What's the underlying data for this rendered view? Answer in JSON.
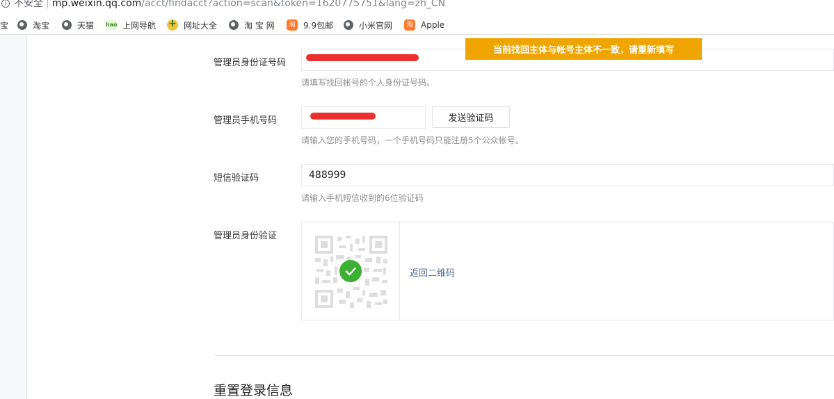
{
  "browser": {
    "security_label": "不安全",
    "url_host": "mp.weixin.qq.com",
    "url_path": "/acct/findacct?action=scan&token=1620775751&lang=zh_CN",
    "bookmarks": [
      {
        "label": "宝",
        "icon": "bookmark-partial"
      },
      {
        "label": "淘宝",
        "icon": "globe-icon"
      },
      {
        "label": "天猫",
        "icon": "globe-icon"
      },
      {
        "label": "上网导航",
        "icon": "hao-icon"
      },
      {
        "label": "网址大全",
        "icon": "nav-icon"
      },
      {
        "label": "淘 宝 网",
        "icon": "globe-icon"
      },
      {
        "label": "9.9包邮",
        "icon": "taobao-icon"
      },
      {
        "label": "小米官网",
        "icon": "globe-icon"
      },
      {
        "label": "Apple",
        "icon": "taobao-icon"
      }
    ]
  },
  "form": {
    "id_card": {
      "label": "管理员身份证号码",
      "hint": "请填写找回帐号的个人身份证号码。",
      "value": ""
    },
    "phone": {
      "label": "管理员手机号码",
      "hint": "请输入您的手机号码，一个手机号码只能注册5个公众帐号。",
      "value": "",
      "send_button": "发送验证码"
    },
    "sms_code": {
      "label": "短信验证码",
      "hint": "请输入手机短信收到的6位验证码",
      "value": "488999"
    },
    "identity_verify": {
      "label": "管理员身份验证",
      "back_link": "返回二维码"
    }
  },
  "toast": {
    "message": "当前找回主体与帐号主体不一致，请重新填写",
    "color": "#f0a400"
  },
  "section": {
    "title": "重置登录信息"
  },
  "colors": {
    "link": "#576b95",
    "success": "#3bb033",
    "redaction": "#e8201d"
  }
}
